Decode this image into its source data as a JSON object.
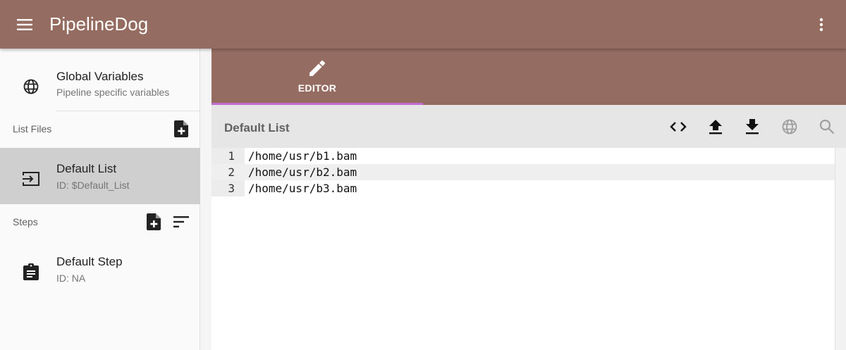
{
  "app": {
    "title": "PipelineDog",
    "menu_icon": "menu-icon",
    "more_icon": "more-vert-icon",
    "brand_color": "#956c61",
    "tab_indicator_color": "#c06cd1"
  },
  "sidebar": {
    "global": {
      "title": "Global Variables",
      "subtitle": "Pipeline specific variables",
      "icon": "globe-icon"
    },
    "list_files": {
      "header": "List Files",
      "add_icon": "note-add-icon",
      "items": [
        {
          "title": "Default List",
          "subtitle": "ID: $Default_List",
          "icon": "input-icon",
          "selected": true
        }
      ]
    },
    "steps": {
      "header": "Steps",
      "add_icon": "note-add-icon",
      "sort_icon": "sort-icon",
      "items": [
        {
          "title": "Default Step",
          "subtitle": "ID: NA",
          "icon": "assignment-icon"
        }
      ]
    }
  },
  "tabs": [
    {
      "label": "EDITOR",
      "icon": "edit-icon",
      "active": true
    }
  ],
  "editor": {
    "title": "Default List",
    "tools": [
      "code-icon",
      "upload-icon",
      "download-icon",
      "globe-icon",
      "search-icon"
    ],
    "active_line": 2,
    "lines": [
      {
        "num": "1",
        "text": "/home/usr/b1.bam"
      },
      {
        "num": "2",
        "text": "/home/usr/b2.bam"
      },
      {
        "num": "3",
        "text": "/home/usr/b3.bam"
      }
    ]
  }
}
